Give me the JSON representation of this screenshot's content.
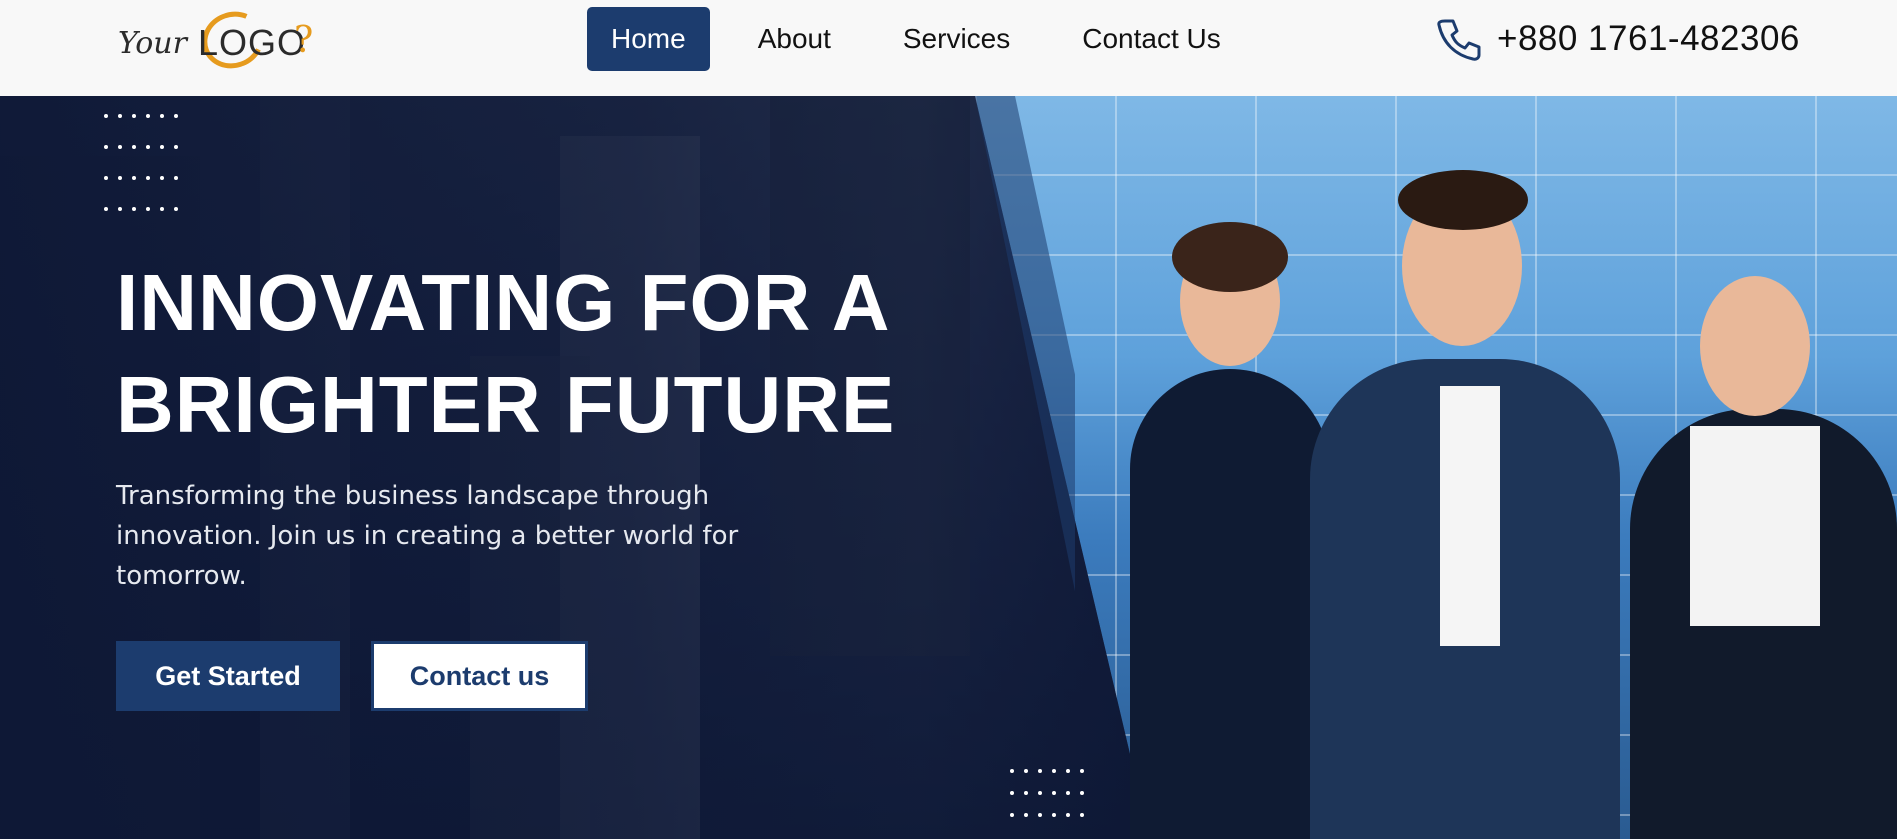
{
  "header": {
    "logo": {
      "prefix": "Your",
      "word": "LOGO",
      "suffix": "?"
    },
    "nav": [
      {
        "label": "Home",
        "active": true
      },
      {
        "label": "About",
        "active": false
      },
      {
        "label": "Services",
        "active": false
      },
      {
        "label": "Contact Us",
        "active": false
      }
    ],
    "phone": {
      "icon": "phone-icon",
      "number": "+880 1761-482306"
    }
  },
  "hero": {
    "title_line1": "INNOVATING FOR A",
    "title_line2": "BRIGHTER FUTURE",
    "subtitle": "Transforming the business landscape through innovation. Join us in creating a better world for tomorrow.",
    "primary_button": "Get Started",
    "secondary_button": "Contact us"
  },
  "colors": {
    "brand_navy": "#1c3c6e",
    "accent_orange": "#e69b1e",
    "hero_overlay": "#0e1a36"
  }
}
